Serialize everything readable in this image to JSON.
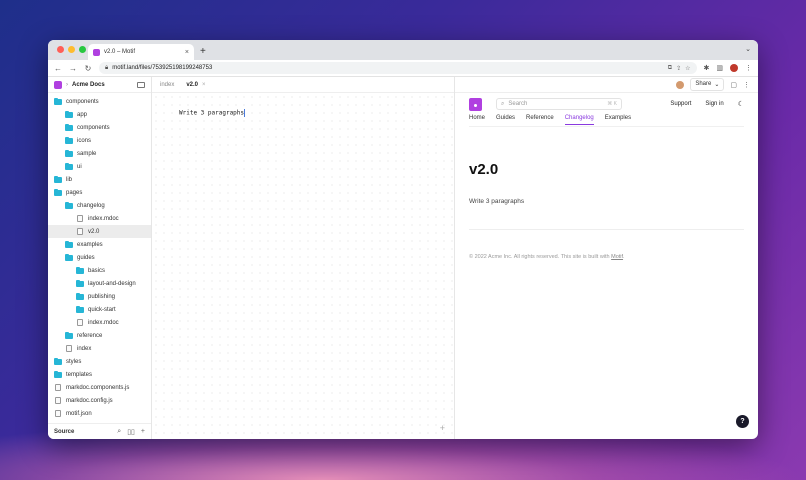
{
  "browser": {
    "tab_title": "v2.0 – Motif",
    "tab_close": "×",
    "new_tab": "+",
    "url": "motif.land/files/753925198199248753",
    "colors": {
      "close": "#ff5f57",
      "minimize": "#febc2e",
      "maximize": "#28c840"
    }
  },
  "sidebar": {
    "project_name": "Acme Docs",
    "items": [
      {
        "label": "components",
        "type": "folder",
        "level": 0
      },
      {
        "label": "app",
        "type": "folder",
        "level": 1
      },
      {
        "label": "components",
        "type": "folder",
        "level": 1
      },
      {
        "label": "icons",
        "type": "folder",
        "level": 1
      },
      {
        "label": "sample",
        "type": "folder",
        "level": 1
      },
      {
        "label": "ui",
        "type": "folder",
        "level": 1
      },
      {
        "label": "lib",
        "type": "folder",
        "level": 0
      },
      {
        "label": "pages",
        "type": "folder",
        "level": 0
      },
      {
        "label": "changelog",
        "type": "folder",
        "level": 1
      },
      {
        "label": "index.mdoc",
        "type": "file",
        "level": 2
      },
      {
        "label": "v2.0",
        "type": "file",
        "level": 2,
        "selected": true
      },
      {
        "label": "examples",
        "type": "folder",
        "level": 1
      },
      {
        "label": "guides",
        "type": "folder",
        "level": 1
      },
      {
        "label": "basics",
        "type": "folder",
        "level": 2
      },
      {
        "label": "layout-and-design",
        "type": "folder",
        "level": 2
      },
      {
        "label": "publishing",
        "type": "folder",
        "level": 2
      },
      {
        "label": "quick-start",
        "type": "folder",
        "level": 2
      },
      {
        "label": "index.mdoc",
        "type": "file",
        "level": 2
      },
      {
        "label": "reference",
        "type": "folder",
        "level": 1
      },
      {
        "label": "index",
        "type": "file",
        "level": 1
      },
      {
        "label": "styles",
        "type": "folder",
        "level": 0
      },
      {
        "label": "templates",
        "type": "folder",
        "level": 0
      },
      {
        "label": "markdoc.components.js",
        "type": "file",
        "level": 0
      },
      {
        "label": "markdoc.config.js",
        "type": "file",
        "level": 0
      },
      {
        "label": "motif.json",
        "type": "file",
        "level": 0
      }
    ],
    "footer_label": "Source"
  },
  "editor": {
    "tabs": [
      {
        "label": "index",
        "active": false
      },
      {
        "label": "v2.0",
        "active": true
      }
    ],
    "content": "Write 3 paragraphs"
  },
  "preview": {
    "share_label": "Share",
    "search_placeholder": "Search",
    "search_shortcut": "⌘ K",
    "support_label": "Support",
    "signin_label": "Sign in",
    "nav": [
      {
        "label": "Home",
        "active": false
      },
      {
        "label": "Guides",
        "active": false
      },
      {
        "label": "Reference",
        "active": false
      },
      {
        "label": "Changelog",
        "active": true
      },
      {
        "label": "Examples",
        "active": false
      }
    ],
    "title": "v2.0",
    "body": "Write 3 paragraphs",
    "footer_prefix": "© 2022 Acme Inc. All rights reserved. This site is built with ",
    "footer_link": "Motif",
    "footer_suffix": ".",
    "help_label": "?"
  }
}
